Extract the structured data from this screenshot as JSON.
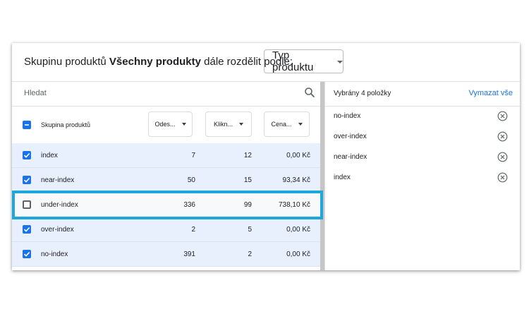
{
  "header": {
    "prefix": "Skupinu produktů",
    "bold": "Všechny produkty",
    "suffix": "dále rozdělit podle:",
    "dropdown_value": "Typ produktu"
  },
  "search": {
    "placeholder": "Hledat",
    "icon": "search-icon"
  },
  "table": {
    "group_header": "Skupina produktů",
    "columns": [
      "Odes...",
      "Klikn...",
      "Cena..."
    ],
    "rows": [
      {
        "name": "index",
        "v1": "7",
        "v2": "12",
        "v3": "0,00 Kč",
        "checked": true
      },
      {
        "name": "near-index",
        "v1": "50",
        "v2": "15",
        "v3": "93,34 Kč",
        "checked": true
      },
      {
        "name": "under-index",
        "v1": "336",
        "v2": "99",
        "v3": "738,10 Kč",
        "checked": false
      },
      {
        "name": "over-index",
        "v1": "2",
        "v2": "5",
        "v3": "0,00 Kč",
        "checked": true
      },
      {
        "name": "no-index",
        "v1": "391",
        "v2": "2",
        "v3": "0,00 Kč",
        "checked": true
      }
    ]
  },
  "selected_panel": {
    "title": "Vybrány 4 položky",
    "clear_label": "Vymazat vše",
    "items": [
      "no-index",
      "over-index",
      "near-index",
      "index"
    ],
    "remove_icon": "close-circle-icon"
  },
  "colors": {
    "accent": "#1a73e8",
    "selected_row": "#e8f0fe",
    "highlight_border": "#1ea7dc"
  }
}
